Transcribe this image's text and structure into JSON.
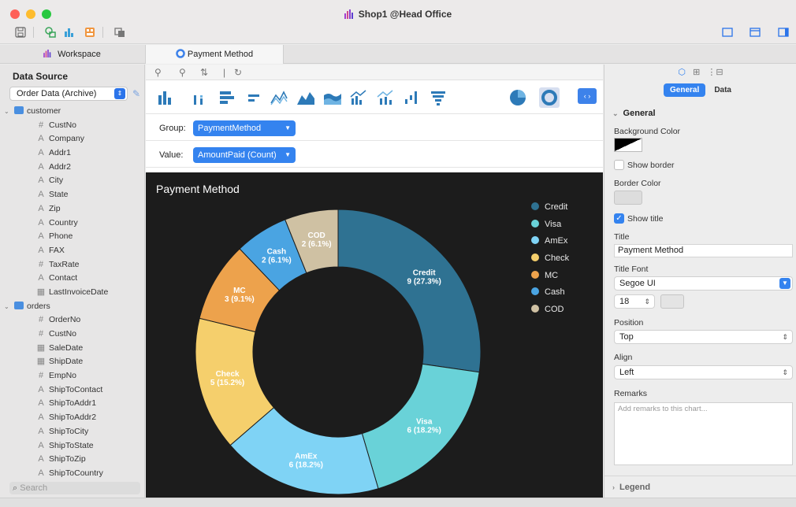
{
  "window": {
    "title": "Shop1 @Head Office"
  },
  "tabs": {
    "workspace": "Workspace",
    "payment": "Payment Method"
  },
  "left_panel": {
    "title": "Data Source",
    "source_select": "Order Data (Archive)",
    "tables": [
      {
        "name": "customer",
        "fields": [
          {
            "type": "#",
            "name": "CustNo"
          },
          {
            "type": "A",
            "name": "Company"
          },
          {
            "type": "A",
            "name": "Addr1"
          },
          {
            "type": "A",
            "name": "Addr2"
          },
          {
            "type": "A",
            "name": "City"
          },
          {
            "type": "A",
            "name": "State"
          },
          {
            "type": "A",
            "name": "Zip"
          },
          {
            "type": "A",
            "name": "Country"
          },
          {
            "type": "A",
            "name": "Phone"
          },
          {
            "type": "A",
            "name": "FAX"
          },
          {
            "type": "#",
            "name": "TaxRate"
          },
          {
            "type": "A",
            "name": "Contact"
          },
          {
            "type": "date",
            "name": "LastInvoiceDate"
          }
        ]
      },
      {
        "name": "orders",
        "fields": [
          {
            "type": "#",
            "name": "OrderNo"
          },
          {
            "type": "#",
            "name": "CustNo"
          },
          {
            "type": "date",
            "name": "SaleDate"
          },
          {
            "type": "date",
            "name": "ShipDate"
          },
          {
            "type": "#",
            "name": "EmpNo"
          },
          {
            "type": "A",
            "name": "ShipToContact"
          },
          {
            "type": "A",
            "name": "ShipToAddr1"
          },
          {
            "type": "A",
            "name": "ShipToAddr2"
          },
          {
            "type": "A",
            "name": "ShipToCity"
          },
          {
            "type": "A",
            "name": "ShipToState"
          },
          {
            "type": "A",
            "name": "ShipToZip"
          },
          {
            "type": "A",
            "name": "ShipToCountry"
          }
        ]
      }
    ],
    "search_placeholder": "Search"
  },
  "editor": {
    "group_label": "Group:",
    "group_value": "PaymentMethod",
    "value_label": "Value:",
    "value_value": "AmountPaid (Count)"
  },
  "chart_data": {
    "type": "pie",
    "variant": "donut",
    "title": "Payment Method",
    "legend_position": "right",
    "categories": [
      "Credit",
      "Visa",
      "AmEx",
      "Check",
      "MC",
      "Cash",
      "COD"
    ],
    "values": [
      9,
      6,
      6,
      5,
      3,
      2,
      2
    ],
    "labels": [
      [
        "Credit",
        "9 (27.3%)"
      ],
      [
        "Visa",
        "6 (18.2%)"
      ],
      [
        "AmEx",
        "6 (18.2%)"
      ],
      [
        "Check",
        "5 (15.2%)"
      ],
      [
        "MC",
        "3 (9.1%)"
      ],
      [
        "Cash",
        "2 (6.1%)"
      ],
      [
        "COD",
        "2 (6.1%)"
      ]
    ],
    "colors": [
      "#2f7292",
      "#69d2d8",
      "#7fd3f5",
      "#f5cf6c",
      "#eda24c",
      "#4aa4e2",
      "#cfc1a3"
    ]
  },
  "right_panel": {
    "tab_general": "General",
    "tab_data": "Data",
    "section_general": "General",
    "background_color_label": "Background Color",
    "show_border_label": "Show border",
    "show_border": false,
    "border_color_label": "Border Color",
    "show_title_label": "Show title",
    "show_title": true,
    "title_label": "Title",
    "title_value": "Payment Method",
    "title_font_label": "Title Font",
    "title_font_value": "Segoe UI",
    "title_size_value": "18",
    "position_label": "Position",
    "position_value": "Top",
    "align_label": "Align",
    "align_value": "Left",
    "remarks_label": "Remarks",
    "remarks_placeholder": "Add remarks to this chart...",
    "section_legend": "Legend"
  }
}
